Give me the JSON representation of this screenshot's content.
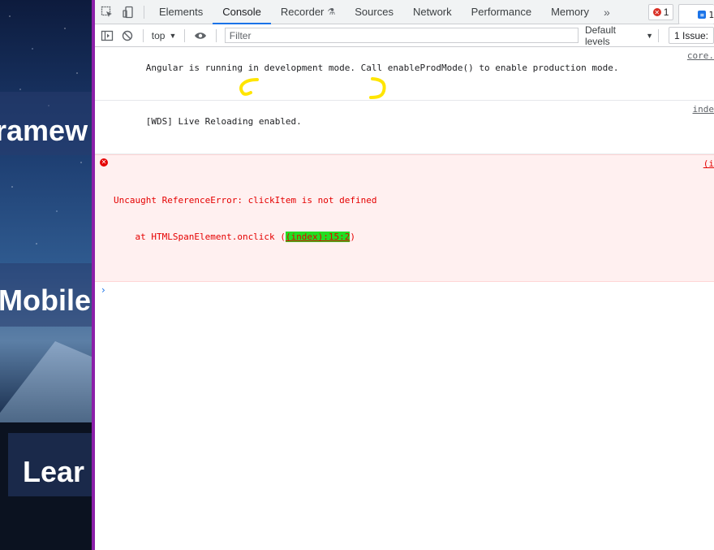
{
  "background_page": {
    "headings": [
      "ramew",
      "Mobile",
      "Lear"
    ]
  },
  "devtools": {
    "tabs": [
      {
        "label": "Elements"
      },
      {
        "label": "Console",
        "active": true
      },
      {
        "label": "Recorder"
      },
      {
        "label": "Sources"
      },
      {
        "label": "Network"
      },
      {
        "label": "Performance"
      },
      {
        "label": "Memory"
      }
    ],
    "more_tabs": "»",
    "error_count": "1",
    "message_count": "1",
    "toolbar": {
      "context": "top",
      "filter_placeholder": "Filter",
      "levels": "Default levels",
      "issues": "1 Issue:"
    },
    "console": {
      "messages": [
        {
          "text": "Angular is running in development mode. Call enableProdMode() to enable production mode.",
          "source": "core."
        },
        {
          "text": "[WDS] Live Reloading enabled.",
          "source": "inde"
        }
      ],
      "error": {
        "line1": "Uncaught ReferenceError: clickItem is not defined",
        "line2_prefix": "    at HTMLSpanElement.onclick (",
        "line2_link": "(index):15:2",
        "line2_suffix": ")",
        "source": "(i"
      },
      "prompt": "›"
    },
    "annotation_colors": {
      "highlight": "#ffe500",
      "link_highlight": "#22dd22"
    }
  }
}
